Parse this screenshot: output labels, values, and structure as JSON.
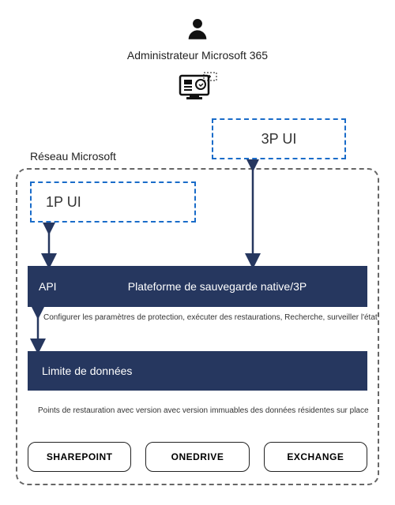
{
  "title": "Administrateur Microsoft 365",
  "network_label": "Réseau Microsoft",
  "third_party_ui": "3P UI",
  "first_party_ui": "1P UI",
  "api_label": "API",
  "platform_label": "Plateforme de sauvegarde native/3P",
  "config_desc": "Configurer les paramètres de protection, exécuter des restaurations, Recherche, surveiller l'état",
  "data_boundary": "Limite de données",
  "restore_desc": "Points de restauration avec version avec version immuables des données résidentes sur place",
  "services": [
    "SHAREPOINT",
    "ONEDRIVE",
    "EXCHANGE"
  ],
  "colors": {
    "dark_blue": "#26375f",
    "dash_blue": "#1a6cc9"
  }
}
